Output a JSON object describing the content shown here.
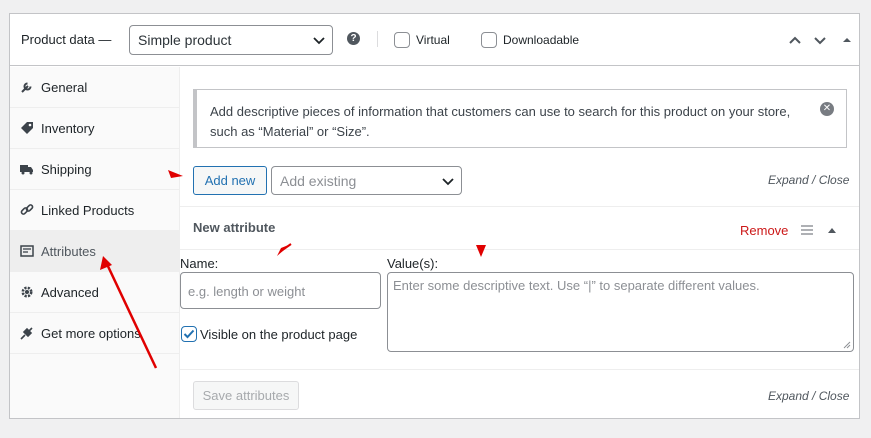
{
  "header": {
    "title": "Product data —",
    "product_type": "Simple product",
    "help_icon": "?",
    "virtual_label": "Virtual",
    "downloadable_label": "Downloadable"
  },
  "tabs": [
    {
      "label": "General",
      "icon": "wrench-icon"
    },
    {
      "label": "Inventory",
      "icon": "tag-icon"
    },
    {
      "label": "Shipping",
      "icon": "truck-icon"
    },
    {
      "label": "Linked Products",
      "icon": "link-icon"
    },
    {
      "label": "Attributes",
      "icon": "list-icon"
    },
    {
      "label": "Advanced",
      "icon": "gear-icon"
    },
    {
      "label": "Get more options",
      "icon": "plugin-icon"
    }
  ],
  "active_tab": "Attributes",
  "notice": {
    "text": "Add descriptive pieces of information that customers can use to search for this product on your store, such as “Material” or “Size”.",
    "close_icon": "✕"
  },
  "toolbar": {
    "add_new": "Add new",
    "add_existing_placeholder": "Add existing",
    "expand_close": "Expand / Close"
  },
  "attribute": {
    "title": "New attribute",
    "remove": "Remove",
    "name_label": "Name:",
    "name_placeholder": "e.g. length or weight",
    "values_label": "Value(s):",
    "values_placeholder": "Enter some descriptive text. Use “|” to separate different values.",
    "visible_label": "Visible on the product page",
    "visible_checked": true
  },
  "footer": {
    "save": "Save attributes",
    "expand_close": "Expand / Close"
  },
  "colors": {
    "link": "#2271b1",
    "remove": "#cc1818",
    "annotation": "#e00000"
  }
}
